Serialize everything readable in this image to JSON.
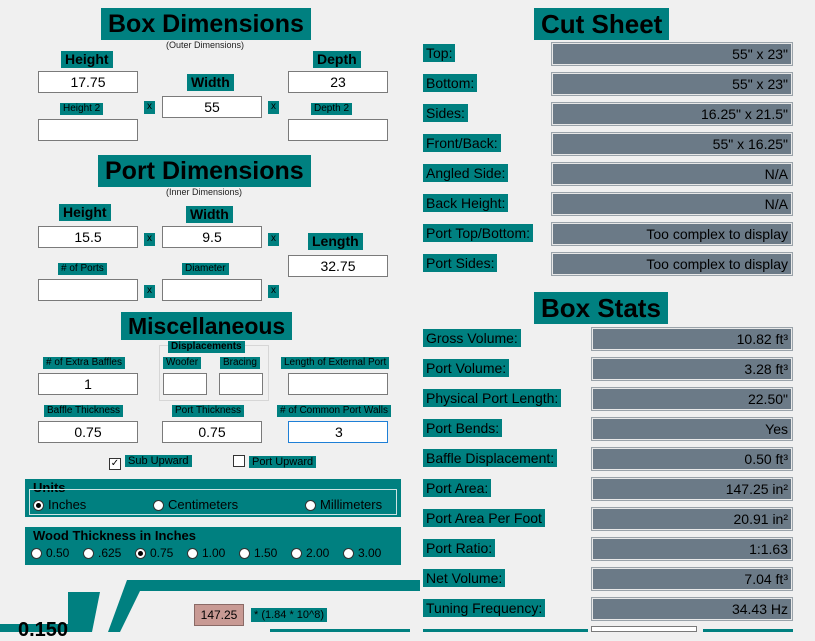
{
  "box_dimensions": {
    "title": "Box Dimensions",
    "subtitle": "(Outer Dimensions)",
    "height_label": "Height",
    "height_value": "17.75",
    "width_label": "Width",
    "width_value": "55",
    "depth_label": "Depth",
    "depth_value": "23",
    "height2_label": "Height 2",
    "height2_value": "",
    "depth2_label": "Depth 2",
    "depth2_value": "",
    "x_mark": "x"
  },
  "port_dimensions": {
    "title": "Port Dimensions",
    "subtitle": "(Inner Dimensions)",
    "height_label": "Height",
    "height_value": "15.5",
    "width_label": "Width",
    "width_value": "9.5",
    "length_label": "Length",
    "length_value": "32.75",
    "num_ports_label": "# of Ports",
    "num_ports_value": "",
    "diameter_label": "Diameter",
    "diameter_value": ""
  },
  "miscellaneous": {
    "title": "Miscellaneous",
    "displacements_label": "Displacements",
    "extra_baffles_label": "# of Extra Baffles",
    "extra_baffles_value": "1",
    "woofer_label": "Woofer",
    "woofer_value": "",
    "bracing_label": "Bracing",
    "bracing_value": "",
    "external_port_label": "Length of External Port",
    "external_port_value": "",
    "baffle_thickness_label": "Baffle Thickness",
    "baffle_thickness_value": "0.75",
    "port_thickness_label": "Port Thickness",
    "port_thickness_value": "0.75",
    "common_walls_label": "# of Common Port Walls",
    "common_walls_value": "3",
    "sub_upward_label": "Sub Upward",
    "sub_upward_checked": "✓",
    "port_upward_label": "Port Upward"
  },
  "units": {
    "title": "Units",
    "options": [
      "Inches",
      "Centimeters",
      "Millimeters"
    ],
    "selected": "Inches"
  },
  "wood_thickness": {
    "title": "Wood Thickness in Inches",
    "options": [
      "0.50",
      ".625",
      "0.75",
      "1.00",
      "1.50",
      "2.00",
      "3.00"
    ],
    "selected": "0.75"
  },
  "cut_sheet": {
    "title": "Cut Sheet",
    "rows": [
      {
        "label": "Top:",
        "value": "55\" x 23\""
      },
      {
        "label": "Bottom:",
        "value": "55\" x 23\""
      },
      {
        "label": "Sides:",
        "value": "16.25\" x 21.5\""
      },
      {
        "label": "Front/Back:",
        "value": "55\" x 16.25\""
      },
      {
        "label": "Angled Side:",
        "value": "N/A"
      },
      {
        "label": "Back Height:",
        "value": "N/A"
      },
      {
        "label": "Port Top/Bottom:",
        "value": "Too complex to display"
      },
      {
        "label": "Port Sides:",
        "value": "Too complex to display"
      }
    ]
  },
  "box_stats": {
    "title": "Box Stats",
    "rows": [
      {
        "label": "Gross Volume:",
        "value": "10.82 ft³"
      },
      {
        "label": "Port Volume:",
        "value": "3.28 ft³"
      },
      {
        "label": "Physical Port Length:",
        "value": "22.50\""
      },
      {
        "label": "Port Bends:",
        "value": "Yes"
      },
      {
        "label": "Baffle Displacement:",
        "value": "0.50 ft³"
      },
      {
        "label": "Port Area:",
        "value": "147.25 in²"
      },
      {
        "label": "Port Area Per Foot",
        "value": "20.91 in²"
      },
      {
        "label": "Port Ratio:",
        "value": "1:1.63"
      },
      {
        "label": "Net Volume:",
        "value": "7.04 ft³"
      },
      {
        "label": "Tuning Frequency:",
        "value": "34.43 Hz"
      }
    ]
  },
  "diagram": {
    "area_value": "147.25",
    "area_formula": "* (1.84 * 10^8)",
    "dimension_value": "0.150"
  },
  "colors": {
    "accent": "#008080",
    "readout": "#6b7a87",
    "area_badge": "#c89a94"
  }
}
